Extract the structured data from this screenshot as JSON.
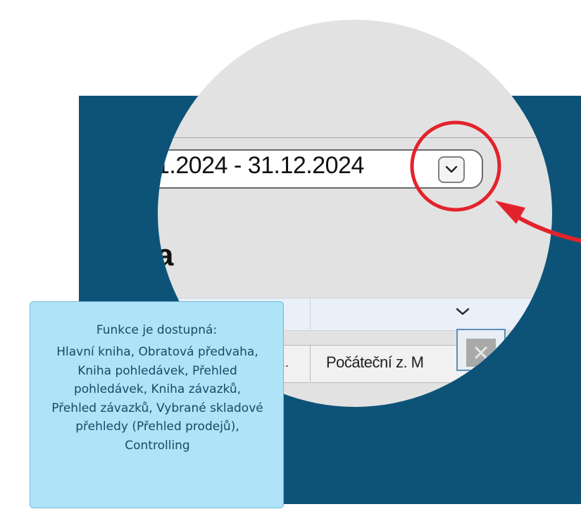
{
  "date_range": "1.2024  - 31.12.2024",
  "partial_heading": "a",
  "column_ellipsis": "...",
  "column_header": "Počáteční z. M",
  "info": {
    "title": "Funkce je dostupná:",
    "body": "Hlavní kniha, Obratová předvaha, Kniha pohledávek, Přehled pohledávek, Kniha závazků, Přehled závazků, Vybrané skladové přehledy (Přehled prodejů), Controlling"
  },
  "colors": {
    "panel": "#0d5378",
    "callout": "#e3232c",
    "info_bg": "#aee3f8",
    "info_text": "#1a4a66"
  },
  "icons": [
    "chevron-down-icon",
    "close-icon",
    "arrow-icon",
    "highlight-circle"
  ]
}
